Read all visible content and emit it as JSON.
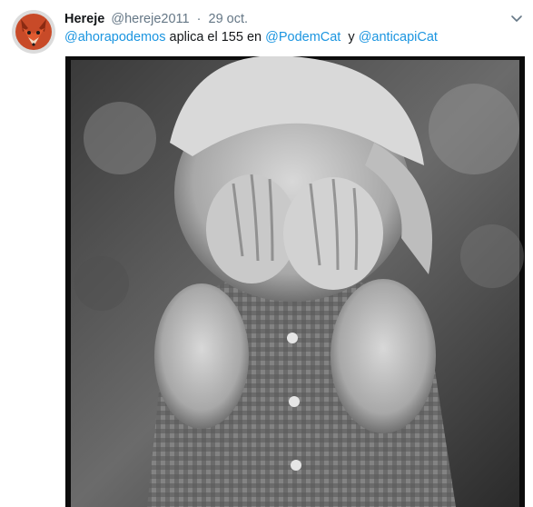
{
  "author": {
    "name": "Hereje",
    "handle": "@hereje2011",
    "separator": "·",
    "timestamp": "29 oct.",
    "avatar_icon": "fox-icon"
  },
  "tweet": {
    "mention_1": "@ahorapodemos",
    "text_1": "aplica el 155 en",
    "mention_2": "@PodemCat",
    "text_2": "y",
    "mention_3": "@anticapiCat"
  },
  "menu": {
    "icon": "chevron-down-icon"
  },
  "media": {
    "type": "photo",
    "icon": "photo-image"
  },
  "colors": {
    "link": "#1b95e0",
    "name": "#14171a",
    "meta": "#657786"
  }
}
